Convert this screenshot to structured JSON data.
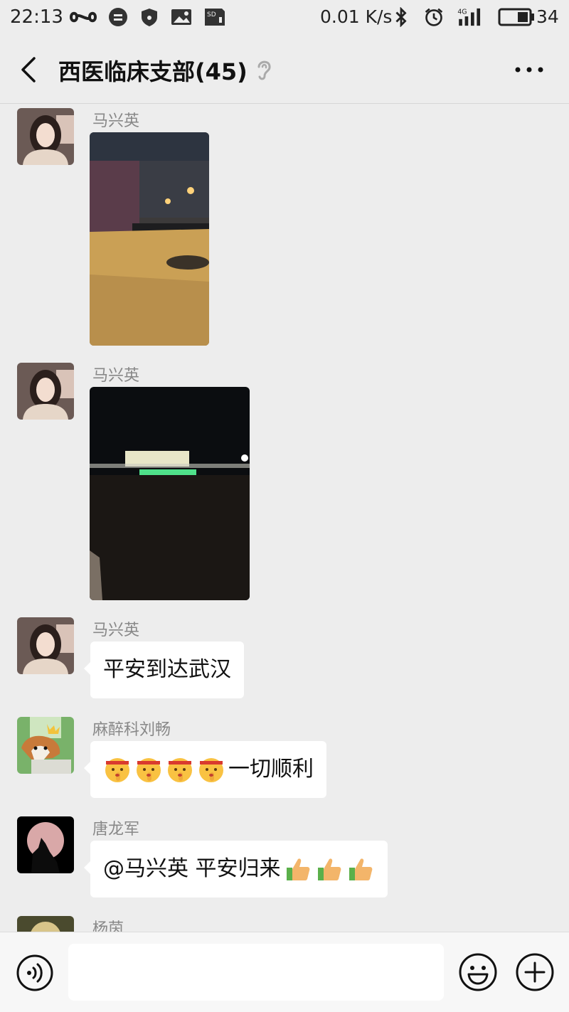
{
  "status_bar": {
    "time": "22:13",
    "net_speed": "0.01 K/s",
    "signal_label": "4G",
    "battery_level": "34"
  },
  "header": {
    "title": "西医临床支部(45)"
  },
  "messages": [
    {
      "sender": "马兴英",
      "type": "image",
      "image_desc": "night-airport-tarmac-yellow"
    },
    {
      "sender": "马兴英",
      "type": "image",
      "image_desc": "night-terminal-building"
    },
    {
      "sender": "马兴英",
      "type": "text",
      "text": "平安到达武汉"
    },
    {
      "sender": "麻醉科刘畅",
      "type": "text",
      "emojis": [
        "shush-emoji",
        "shush-emoji",
        "shush-emoji",
        "shush-emoji"
      ],
      "text": "一切顺利"
    },
    {
      "sender": "唐龙军",
      "type": "text",
      "text": "@马兴英  平安归来",
      "emojis_after": [
        "thumbs-up-emoji",
        "thumbs-up-emoji",
        "thumbs-up-emoji"
      ]
    },
    {
      "sender": "杨茵",
      "type": "text",
      "text": ""
    }
  ],
  "input_bar": {
    "placeholder": ""
  },
  "colors": {
    "background": "#ededed",
    "bubble": "#ffffff",
    "sender_name": "#888888"
  },
  "icons": [
    "back-icon",
    "infinity-icon",
    "message-icon",
    "shield-icon",
    "image-icon",
    "sd-card-icon",
    "bluetooth-icon",
    "alarm-icon",
    "signal-icon",
    "battery-icon",
    "ear-icon",
    "more-icon",
    "voice-icon",
    "emoji-icon",
    "plus-icon"
  ]
}
